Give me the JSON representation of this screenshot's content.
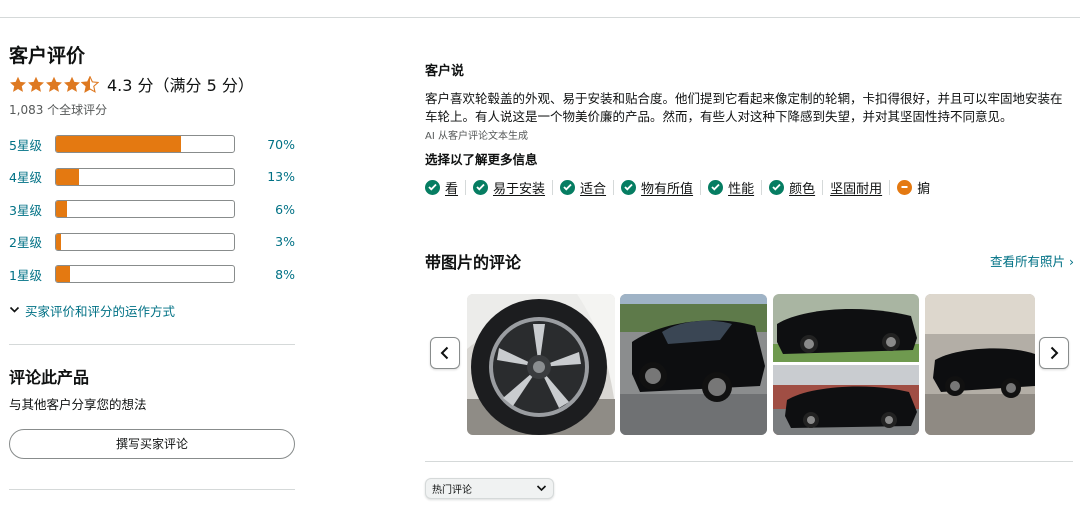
{
  "ratings": {
    "title": "客户评价",
    "average_text": "4.3 分（满分 5 分）",
    "average_value": 4.3,
    "global_count": "1,083 个全球评分",
    "histogram": [
      {
        "label": "5星级",
        "percent_text": "70%",
        "percent": 70
      },
      {
        "label": "4星级",
        "percent_text": "13%",
        "percent": 13
      },
      {
        "label": "3星级",
        "percent_text": "6%",
        "percent": 6
      },
      {
        "label": "2星级",
        "percent_text": "3%",
        "percent": 3
      },
      {
        "label": "1星级",
        "percent_text": "8%",
        "percent": 8
      }
    ],
    "how_link": "买家评价和评分的运作方式",
    "star_color": "#de7921",
    "bar_color": "#e47911"
  },
  "review_product": {
    "title": "评论此产品",
    "subtitle": "与其他客户分享您的想法",
    "button": "撰写买家评论"
  },
  "customers_say": {
    "title": "客户说",
    "body": "客户喜欢轮毂盖的外观、易于安装和贴合度。他们提到它看起来像定制的轮辋，卡扣得很好，并且可以牢固地安装在车轮上。有人说这是一个物美价廉的产品。然而，有些人对这种下降感到失望，并对其坚固性持不同意见。",
    "ai_note": "AI 从客户评论文本生成",
    "more_title": "选择以了解更多信息",
    "aspects": [
      {
        "label": "看",
        "icon": "check-icon",
        "sentiment": "positive"
      },
      {
        "label": "易于安装",
        "icon": "check-icon",
        "sentiment": "positive"
      },
      {
        "label": "适合",
        "icon": "check-icon",
        "sentiment": "positive"
      },
      {
        "label": "物有所值",
        "icon": "check-icon",
        "sentiment": "positive"
      },
      {
        "label": "性能",
        "icon": "check-icon",
        "sentiment": "positive"
      },
      {
        "label": "颜色",
        "icon": "check-icon",
        "sentiment": "positive"
      },
      {
        "label": "坚固耐用",
        "icon": "",
        "sentiment": "mixed"
      },
      {
        "label": "掮",
        "icon": "minus-icon",
        "sentiment": "negative"
      }
    ]
  },
  "photo_reviews": {
    "title": "带图片的评论",
    "see_all": "查看所有照片 ›",
    "prev_icon": "chevron-left-icon",
    "next_icon": "chevron-right-icon"
  },
  "sort": {
    "selected": "热门评论"
  }
}
